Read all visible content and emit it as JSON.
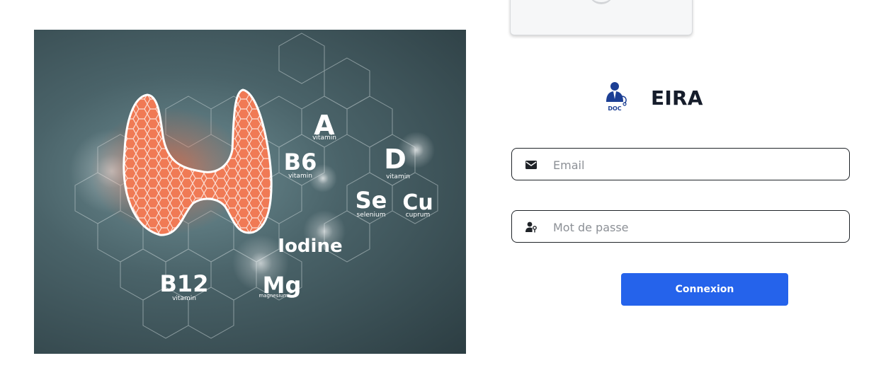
{
  "app": {
    "title": "EIRA",
    "logo_text": "DOC"
  },
  "hero": {
    "nutrients": [
      {
        "symbol": "A",
        "sub": "vitamin"
      },
      {
        "symbol": "B6",
        "sub": "vitamin"
      },
      {
        "symbol": "D",
        "sub": "vitamin"
      },
      {
        "symbol": "Se",
        "sub": "selenium"
      },
      {
        "symbol": "Cu",
        "sub": "cuprum"
      },
      {
        "symbol": "Iodine",
        "sub": ""
      },
      {
        "symbol": "B12",
        "sub": "vitamin"
      },
      {
        "symbol": "Mg",
        "sub": "magnesium"
      }
    ]
  },
  "form": {
    "email": {
      "placeholder": "Email",
      "value": "",
      "icon": "mail-icon"
    },
    "password": {
      "placeholder": "Mot de passe",
      "value": "",
      "icon": "user-lock-icon"
    },
    "submit_label": "Connexion"
  },
  "colors": {
    "accent": "#2563eb",
    "title": "#161d2b",
    "logo_blue": "#1c3f94",
    "hero_bg": "#3f555b",
    "thyroid": "#e8603a"
  }
}
